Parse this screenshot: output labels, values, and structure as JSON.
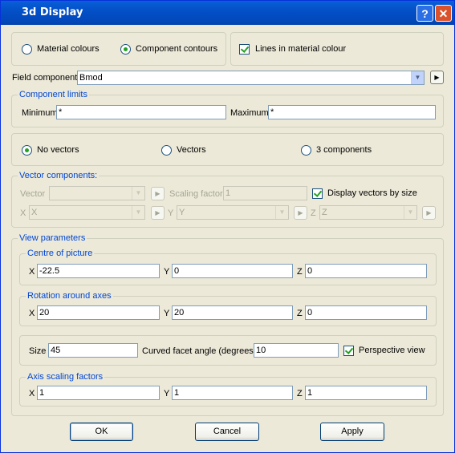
{
  "window": {
    "title": "3d Display"
  },
  "title_buttons": {
    "help": "?",
    "close": "✕"
  },
  "display_mode": {
    "material_colours": "Material colours",
    "component_contours": "Component contours",
    "selected": "component_contours"
  },
  "lines_in_material_colour": {
    "label": "Lines in material colour",
    "checked": true
  },
  "field_component": {
    "label": "Field component",
    "value": "Bmod",
    "arrow": "▶"
  },
  "component_limits": {
    "legend": "Component limits",
    "minimum_label": "Minimum",
    "minimum_value": "*",
    "maximum_label": "Maximum",
    "maximum_value": "*"
  },
  "vectors_mode": {
    "no_vectors": "No vectors",
    "vectors": "Vectors",
    "three_components": "3 components",
    "selected": "no_vectors"
  },
  "vector_components": {
    "legend": "Vector components:",
    "vector_label": "Vector",
    "vector_value": "",
    "scaling_label": "Scaling factor",
    "scaling_value": "1",
    "display_by_size_label": "Display vectors by size",
    "display_by_size_checked": true,
    "x_label": "X",
    "x_value": "X",
    "y_label": "Y",
    "y_value": "Y",
    "z_label": "Z",
    "z_value": "Z"
  },
  "view_parameters": {
    "legend": "View parameters",
    "centre": {
      "legend": "Centre of picture",
      "x_label": "X",
      "x": "-22.5",
      "y_label": "Y",
      "y": "0",
      "z_label": "Z",
      "z": "0"
    },
    "rotation": {
      "legend": "Rotation around axes",
      "x_label": "X",
      "x": "20",
      "y_label": "Y",
      "y": "20",
      "z_label": "Z",
      "z": "0"
    },
    "size_label": "Size",
    "size": "45",
    "facet_label": "Curved facet angle (degrees)",
    "facet": "10",
    "perspective_label": "Perspective view",
    "perspective_checked": true,
    "axis_scaling": {
      "legend": "Axis scaling factors",
      "x_label": "X",
      "x": "1",
      "y_label": "Y",
      "y": "1",
      "z_label": "Z",
      "z": "1"
    }
  },
  "buttons": {
    "ok": "OK",
    "cancel": "Cancel",
    "apply": "Apply"
  },
  "colors": {
    "titlebar": "#0350c8",
    "dialog_bg": "#ece9d8",
    "group_legend": "#0046d5",
    "check_mark": "#21a121"
  }
}
